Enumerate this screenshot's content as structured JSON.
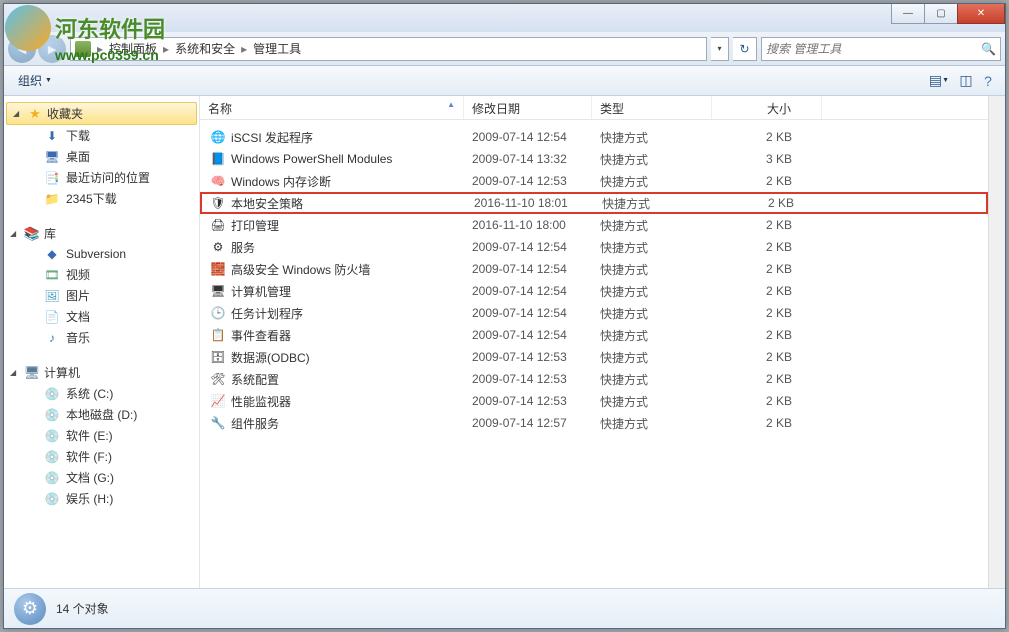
{
  "watermark": {
    "text": "河东软件园",
    "url": "www.pc0359.cn"
  },
  "window_controls": {
    "min": "—",
    "max": "▢",
    "close": "✕"
  },
  "breadcrumb": {
    "root_icon": "cp",
    "items": [
      "控制面板",
      "系统和安全",
      "管理工具"
    ],
    "sep": "▸"
  },
  "search": {
    "placeholder": "搜索 管理工具"
  },
  "cmdbar": {
    "organize": "组织"
  },
  "nav": {
    "favorites": {
      "label": "收藏夹",
      "items": [
        {
          "icon": "⬇",
          "cls": "i-blue",
          "label": "下载"
        },
        {
          "icon": "🖥",
          "cls": "i-blue",
          "label": "桌面"
        },
        {
          "icon": "📑",
          "cls": "i-doc",
          "label": "最近访问的位置"
        },
        {
          "icon": "📁",
          "cls": "i-folder",
          "label": "2345下载"
        }
      ]
    },
    "libraries": {
      "label": "库",
      "items": [
        {
          "icon": "◆",
          "cls": "i-blue",
          "label": "Subversion"
        },
        {
          "icon": "🎞",
          "cls": "i-video",
          "label": "视频"
        },
        {
          "icon": "🖼",
          "cls": "i-pic",
          "label": "图片"
        },
        {
          "icon": "📄",
          "cls": "i-doc",
          "label": "文档"
        },
        {
          "icon": "♪",
          "cls": "i-music",
          "label": "音乐"
        }
      ]
    },
    "computer": {
      "label": "计算机",
      "items": [
        {
          "icon": "💿",
          "cls": "i-drive",
          "label": "系统 (C:)",
          "win": true
        },
        {
          "icon": "💿",
          "cls": "i-drive",
          "label": "本地磁盘 (D:)"
        },
        {
          "icon": "💿",
          "cls": "i-drive",
          "label": "软件 (E:)"
        },
        {
          "icon": "💿",
          "cls": "i-drive",
          "label": "软件 (F:)"
        },
        {
          "icon": "💿",
          "cls": "i-drive",
          "label": "文档 (G:)"
        },
        {
          "icon": "💿",
          "cls": "i-drive",
          "label": "娱乐 (H:)"
        }
      ]
    }
  },
  "columns": {
    "name": "名称",
    "date": "修改日期",
    "type": "类型",
    "size": "大小"
  },
  "files": [
    {
      "icon": "🌐",
      "name": "iSCSI 发起程序",
      "date": "2009-07-14 12:54",
      "type": "快捷方式",
      "size": "2 KB"
    },
    {
      "icon": "📘",
      "name": "Windows PowerShell Modules",
      "date": "2009-07-14 13:32",
      "type": "快捷方式",
      "size": "3 KB"
    },
    {
      "icon": "🧠",
      "name": "Windows 内存诊断",
      "date": "2009-07-14 12:53",
      "type": "快捷方式",
      "size": "2 KB"
    },
    {
      "icon": "🛡",
      "name": "本地安全策略",
      "date": "2016-11-10 18:01",
      "type": "快捷方式",
      "size": "2 KB",
      "hl": true
    },
    {
      "icon": "🖨",
      "name": "打印管理",
      "date": "2016-11-10 18:00",
      "type": "快捷方式",
      "size": "2 KB"
    },
    {
      "icon": "⚙",
      "name": "服务",
      "date": "2009-07-14 12:54",
      "type": "快捷方式",
      "size": "2 KB"
    },
    {
      "icon": "🧱",
      "name": "高级安全 Windows 防火墙",
      "date": "2009-07-14 12:54",
      "type": "快捷方式",
      "size": "2 KB"
    },
    {
      "icon": "🖥",
      "name": "计算机管理",
      "date": "2009-07-14 12:54",
      "type": "快捷方式",
      "size": "2 KB"
    },
    {
      "icon": "🕒",
      "name": "任务计划程序",
      "date": "2009-07-14 12:54",
      "type": "快捷方式",
      "size": "2 KB"
    },
    {
      "icon": "📋",
      "name": "事件查看器",
      "date": "2009-07-14 12:54",
      "type": "快捷方式",
      "size": "2 KB"
    },
    {
      "icon": "🗄",
      "name": "数据源(ODBC)",
      "date": "2009-07-14 12:53",
      "type": "快捷方式",
      "size": "2 KB"
    },
    {
      "icon": "🛠",
      "name": "系统配置",
      "date": "2009-07-14 12:53",
      "type": "快捷方式",
      "size": "2 KB"
    },
    {
      "icon": "📈",
      "name": "性能监视器",
      "date": "2009-07-14 12:53",
      "type": "快捷方式",
      "size": "2 KB"
    },
    {
      "icon": "🔧",
      "name": "组件服务",
      "date": "2009-07-14 12:57",
      "type": "快捷方式",
      "size": "2 KB"
    }
  ],
  "status": {
    "text": "14 个对象"
  }
}
